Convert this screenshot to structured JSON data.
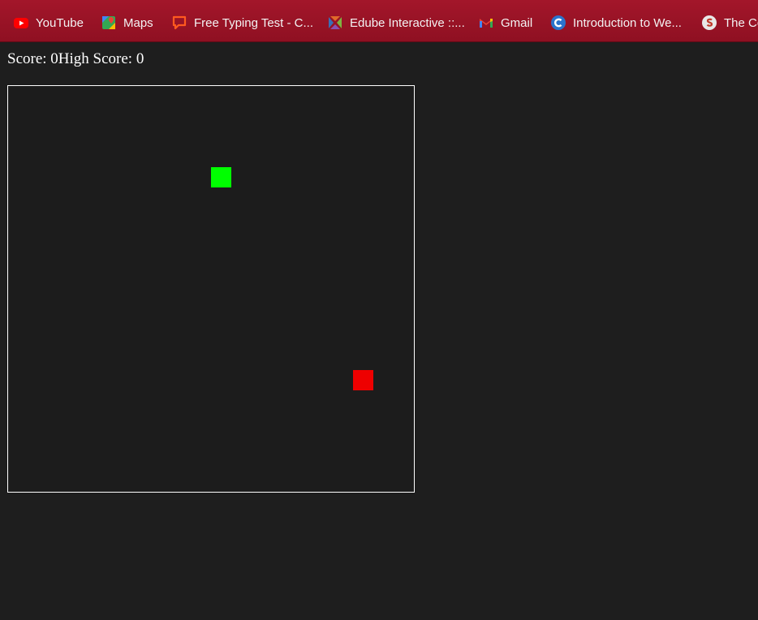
{
  "bookmarks": [
    {
      "label": "YouTube",
      "icon": "youtube-icon"
    },
    {
      "label": "Maps",
      "icon": "maps-icon"
    },
    {
      "label": "Free Typing Test - C...",
      "icon": "typing-test-icon"
    },
    {
      "label": "Edube Interactive ::...",
      "icon": "edube-icon"
    },
    {
      "label": "Gmail",
      "icon": "gmail-icon"
    },
    {
      "label": "Introduction to We...",
      "icon": "coursera-icon"
    },
    {
      "label": "The Co",
      "icon": "site-icon"
    }
  ],
  "game": {
    "score_label": "Score: 0",
    "high_score_label": "High Score: 0",
    "snake_color": "#00ff00",
    "food_color": "#ee0000"
  }
}
